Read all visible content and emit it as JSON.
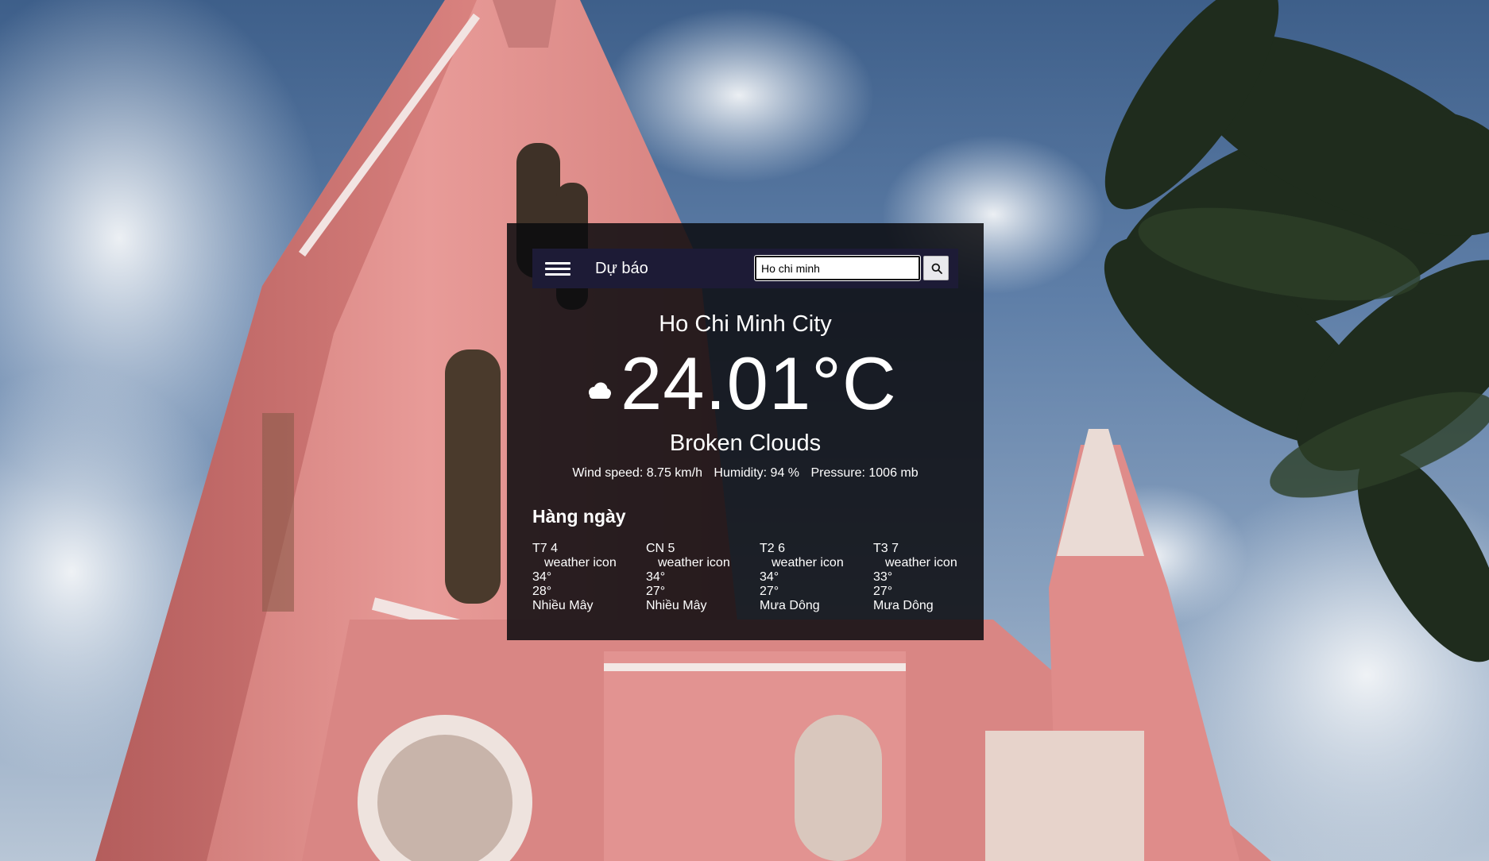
{
  "header": {
    "brand": "Dự báo",
    "search": {
      "value": "Ho chi minh",
      "placeholder": ""
    }
  },
  "current": {
    "city": "Ho Chi Minh City",
    "temperature": "24.01°C",
    "description": "Broken Clouds",
    "icon": "cloud-icon",
    "wind": "Wind speed: 8.75 km/h",
    "humidity": "Humidity: 94 %",
    "pressure": "Pressure: 1006 mb"
  },
  "daily": {
    "title": "Hàng ngày",
    "days": [
      {
        "label": "T7 4",
        "icon_alt": "weather icon",
        "high": "34°",
        "low": "28°",
        "summary": "Nhiều Mây"
      },
      {
        "label": "CN 5",
        "icon_alt": "weather icon",
        "high": "34°",
        "low": "27°",
        "summary": "Nhiều Mây"
      },
      {
        "label": "T2 6",
        "icon_alt": "weather icon",
        "high": "34°",
        "low": "27°",
        "summary": "Mưa Dông"
      },
      {
        "label": "T3 7",
        "icon_alt": "weather icon",
        "high": "33°",
        "low": "27°",
        "summary": "Mưa Dông"
      }
    ]
  },
  "colors": {
    "panel_bg": "#0a0a0e",
    "topbar_bg": "#1d1b36",
    "text": "#ffffff"
  }
}
